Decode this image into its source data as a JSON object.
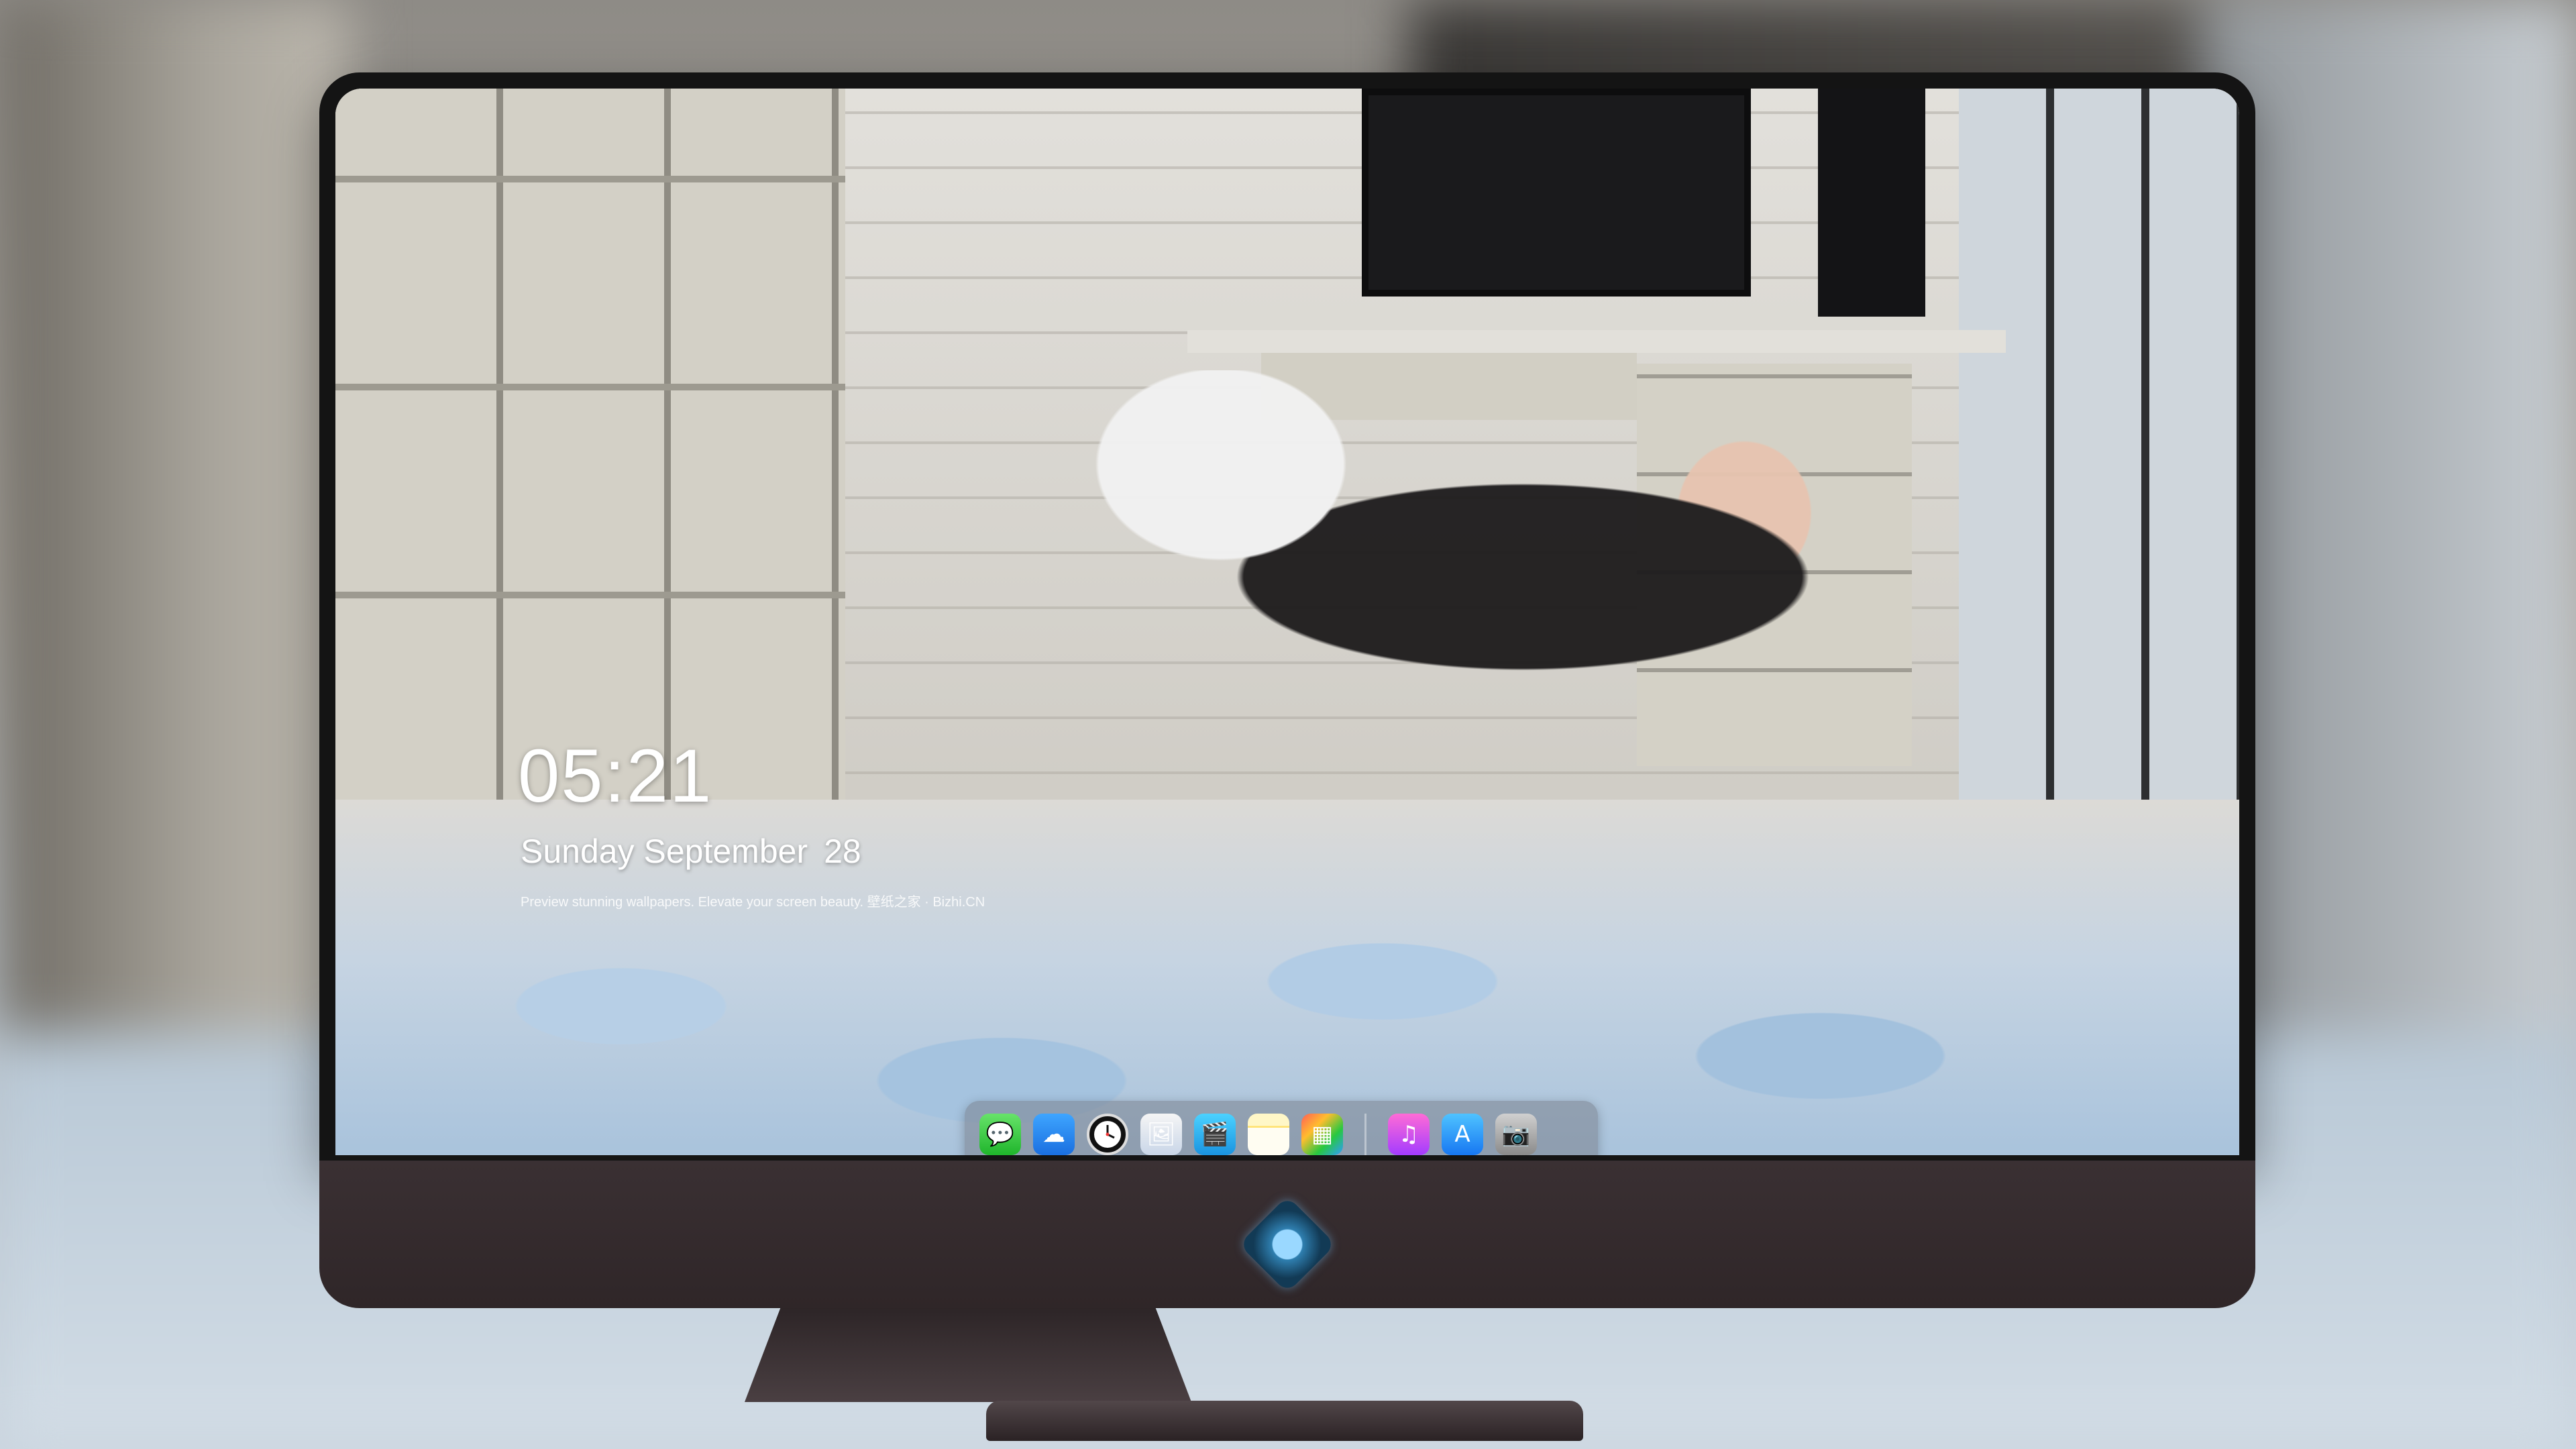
{
  "lockscreen": {
    "time": "05:21",
    "weekday": "Sunday",
    "month": "September",
    "day": "28",
    "caption": "Preview stunning wallpapers. Elevate your screen beauty. 壁纸之家 · Bizhi.CN"
  },
  "dock": {
    "apps": [
      {
        "name": "Messages",
        "icon": "messages-icon",
        "glyph": "💬"
      },
      {
        "name": "Weather",
        "icon": "weather-icon",
        "glyph": "☁"
      },
      {
        "name": "Clock",
        "icon": "clock-icon",
        "glyph": "🕘"
      },
      {
        "name": "Preview",
        "icon": "preview-icon",
        "glyph": "🖼"
      },
      {
        "name": "Clips",
        "icon": "clips-icon",
        "glyph": "🎬"
      },
      {
        "name": "Notes",
        "icon": "notes-icon",
        "glyph": ""
      },
      {
        "name": "Photos",
        "icon": "photos-icon",
        "glyph": "▦"
      },
      {
        "name": "Music",
        "icon": "music-icon",
        "glyph": "♫"
      },
      {
        "name": "App Store",
        "icon": "app-store-icon",
        "glyph": "A"
      },
      {
        "name": "Camera",
        "icon": "camera-icon",
        "glyph": "📷"
      }
    ]
  },
  "colors": {
    "bezel": "#141414",
    "chin": "#3a3033",
    "dock_bg": "rgba(120,128,140,0.55)"
  }
}
